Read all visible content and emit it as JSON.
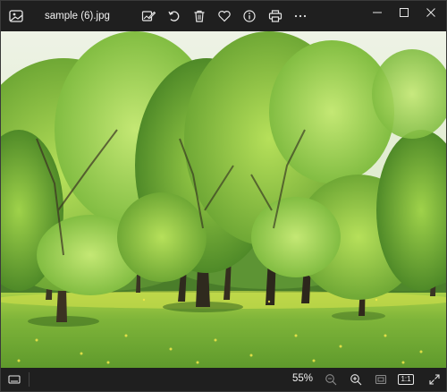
{
  "window": {
    "filename": "sample (6).jpg"
  },
  "toolbar": {
    "icons": [
      "edit-image-icon",
      "rotate-icon",
      "delete-icon",
      "favorite-icon",
      "info-icon",
      "print-icon",
      "more-icon"
    ]
  },
  "window_controls": [
    "minimize-icon",
    "maximize-icon",
    "close-icon"
  ],
  "status": {
    "zoom_label": "55%",
    "actual_size_label": "1:1"
  },
  "colors": {
    "bar_bg": "#1f1f1f",
    "icon": "#e6e6e6",
    "grass": "#6fae2f",
    "foliage": "#8cc63f"
  }
}
